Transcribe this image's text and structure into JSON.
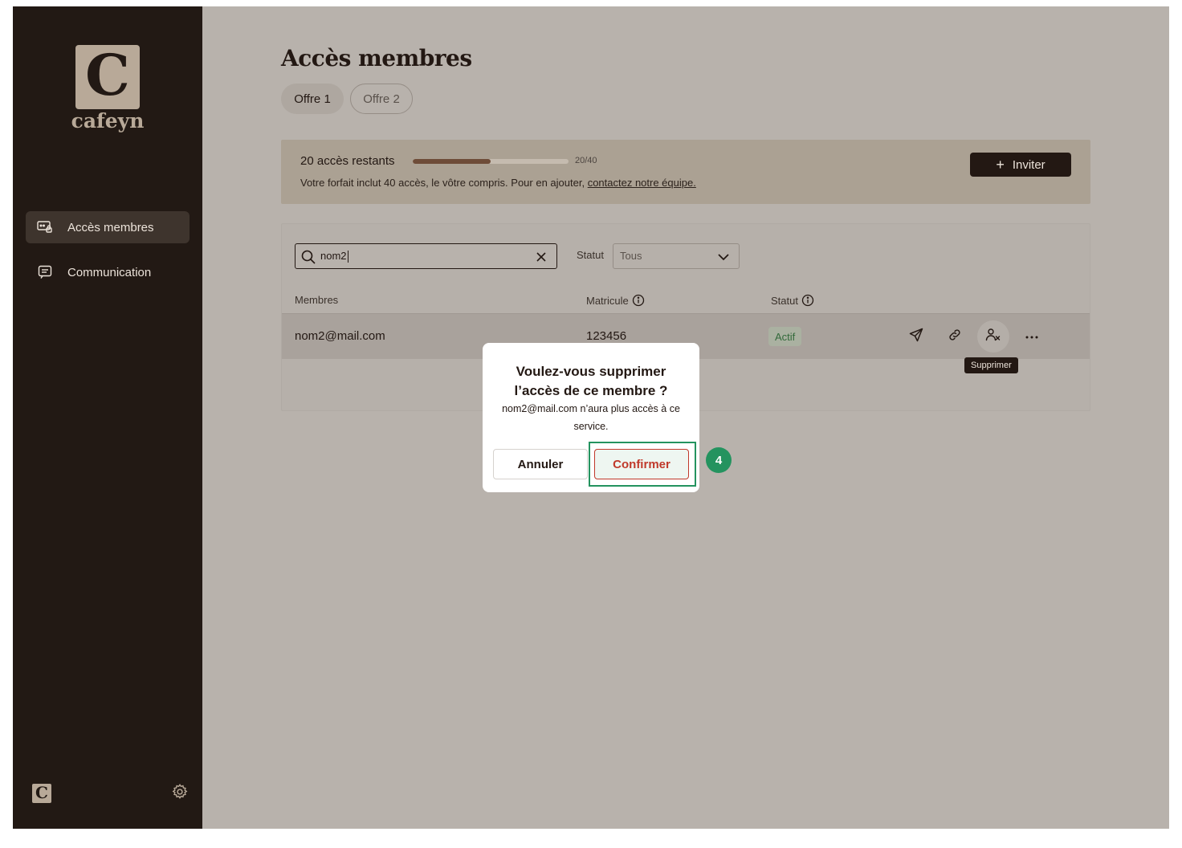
{
  "sidebar": {
    "brand": {
      "letter": "C",
      "word": "cafeyn"
    },
    "items": [
      {
        "label": "Accès membres",
        "icon": "member-access-icon",
        "active": true
      },
      {
        "label": "Communication",
        "icon": "message-icon",
        "active": false
      }
    ],
    "footer": {
      "logo_letter": "C",
      "settings_icon": "gear-icon"
    }
  },
  "main": {
    "title": "Accès membres",
    "tabs": [
      {
        "label": "Offre 1",
        "active": true
      },
      {
        "label": "Offre 2",
        "active": false
      }
    ],
    "quota": {
      "title": "20 accès restants",
      "progress": 0.5,
      "count": "20/40",
      "description": "Votre forfait inclut 40 accès, le vôtre compris. Pour en ajouter, ",
      "link": "contactez notre équipe.",
      "invite_label": "Inviter"
    },
    "filters": {
      "search_value": "nom2",
      "status_label": "Statut",
      "status_value": "Tous"
    },
    "table": {
      "headers": {
        "members": "Membres",
        "matricule": "Matricule",
        "status": "Statut"
      },
      "rows": [
        {
          "email": "nom2@mail.com",
          "matricule": "123456",
          "status": "Actif"
        }
      ]
    },
    "tooltip": "Supprimer"
  },
  "dialog": {
    "title": "Voulez-vous supprimer l’accès de ce membre ?",
    "body": "nom2@mail.com n’aura plus accès à ce service.",
    "cancel_label": "Annuler",
    "confirm_label": "Confirmer",
    "step": "4"
  },
  "colors": {
    "sidebar_bg": "#221914",
    "overlay_bg": "#b8b2ac",
    "accent_green": "#24935f",
    "danger": "#c0392b"
  }
}
